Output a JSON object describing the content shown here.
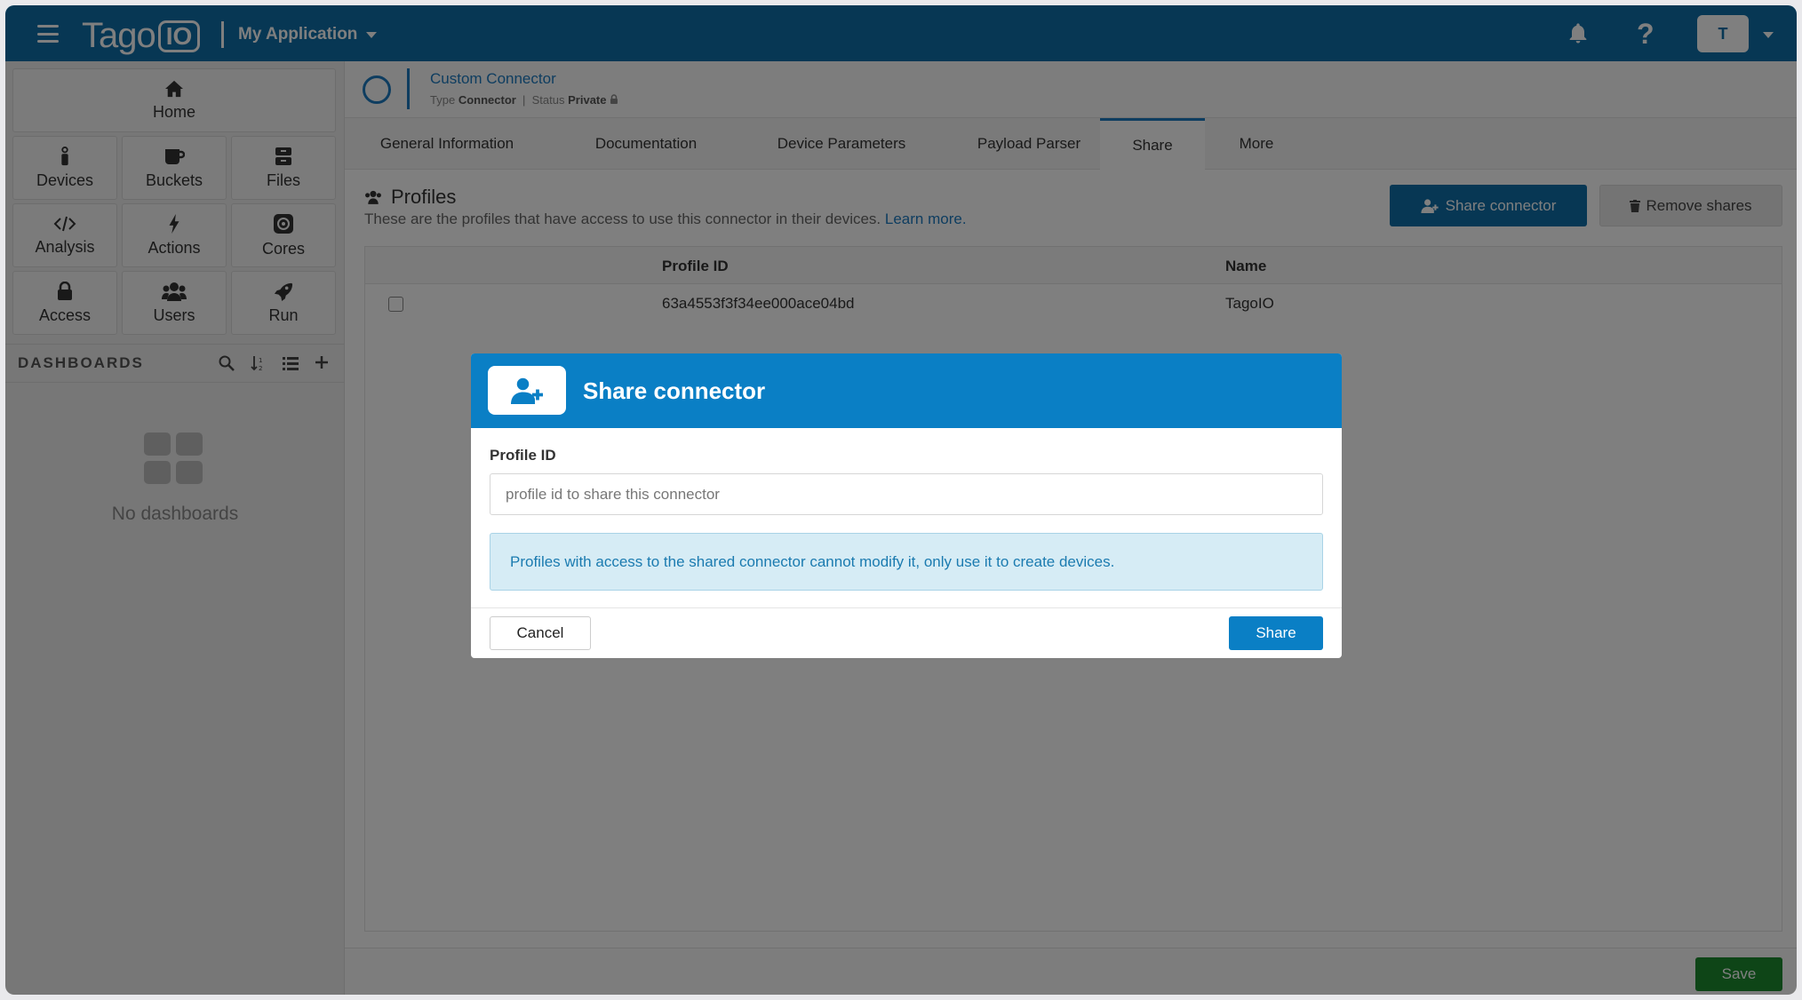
{
  "topbar": {
    "brand_word": "Tago",
    "brand_io": "IO",
    "app_name": "My Application",
    "help_glyph": "?",
    "avatar_initial": "T",
    "color": "#0e6ea8"
  },
  "sidebar": {
    "home": {
      "label": "Home",
      "icon": "home-icon"
    },
    "items": [
      {
        "label": "Devices",
        "icon": "device-icon"
      },
      {
        "label": "Buckets",
        "icon": "bucket-icon"
      },
      {
        "label": "Files",
        "icon": "files-icon"
      },
      {
        "label": "Analysis",
        "icon": "code-icon"
      },
      {
        "label": "Actions",
        "icon": "bolt-icon"
      },
      {
        "label": "Cores",
        "icon": "cores-icon"
      },
      {
        "label": "Access",
        "icon": "lock-icon"
      },
      {
        "label": "Users",
        "icon": "users-icon"
      },
      {
        "label": "Run",
        "icon": "rocket-icon"
      }
    ],
    "dashboards_title": "DASHBOARDS",
    "no_dashboards": "No dashboards"
  },
  "connector": {
    "name": "Custom Connector",
    "type_label": "Type",
    "type_value": "Connector",
    "status_label": "Status",
    "status_value": "Private"
  },
  "tabs": [
    {
      "label": "General Information"
    },
    {
      "label": "Documentation"
    },
    {
      "label": "Device Parameters"
    },
    {
      "label": "Payload Parser"
    },
    {
      "label": "Share",
      "active": true
    },
    {
      "label": "More"
    }
  ],
  "profiles": {
    "title": "Profiles",
    "description": "These are the profiles that have access to use this connector in their devices.",
    "learn_more": "Learn more.",
    "share_button": "Share connector",
    "remove_button": "Remove shares",
    "columns": [
      "Profile ID",
      "Name"
    ],
    "rows": [
      {
        "profile_id": "63a4553f3f34ee000ace04bd",
        "name": "TagoIO"
      }
    ]
  },
  "footer": {
    "save": "Save",
    "save_color": "#1d8a2e"
  },
  "modal": {
    "title": "Share connector",
    "field_label": "Profile ID",
    "field_placeholder": "profile id to share this connector",
    "field_value": "",
    "info": "Profiles with access to the shared connector cannot modify it, only use it to create devices.",
    "cancel": "Cancel",
    "share": "Share",
    "accent": "#0a7fc5"
  }
}
